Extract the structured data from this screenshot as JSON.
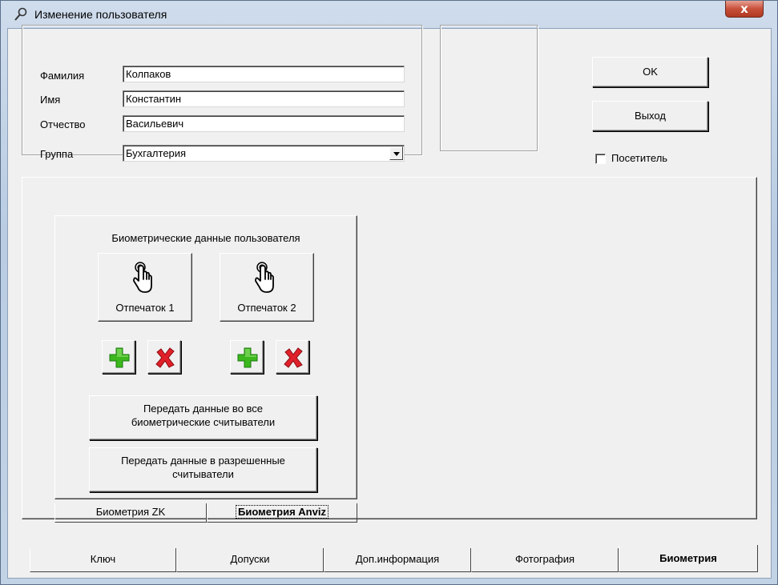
{
  "window": {
    "title": "Изменение пользователя",
    "close_label": "x",
    "icon": "wrench-icon"
  },
  "form": {
    "last_name_label": "Фамилия",
    "last_name_value": "Колпаков",
    "first_name_label": "Имя",
    "first_name_value": "Константин",
    "middle_name_label": "Отчество",
    "middle_name_value": "Васильевич",
    "group_label": "Группа",
    "group_value": "Бухгалтерия"
  },
  "buttons": {
    "ok": "OK",
    "exit": "Выход",
    "visitor_label": "Посетитель"
  },
  "biometrics": {
    "title": "Биометрические данные пользователя",
    "fingerprint1": "Отпечаток 1",
    "fingerprint2": "Отпечаток 2",
    "send_all": "Передать данные во все биометрические считыватели",
    "send_allowed": "Передать данные в разрешенные считыватели",
    "icons": {
      "fingerprint": "hand-pointer-icon",
      "add": "plus-icon",
      "delete": "cross-icon"
    },
    "colors": {
      "add": "#3cb81e",
      "delete": "#e0202a"
    }
  },
  "inner_tabs": [
    "Биометрия ZK",
    "Биометрия Anviz"
  ],
  "bottom_tabs": [
    "Ключ",
    "Допуски",
    "Доп.информация",
    "Фотография",
    "Биометрия"
  ]
}
